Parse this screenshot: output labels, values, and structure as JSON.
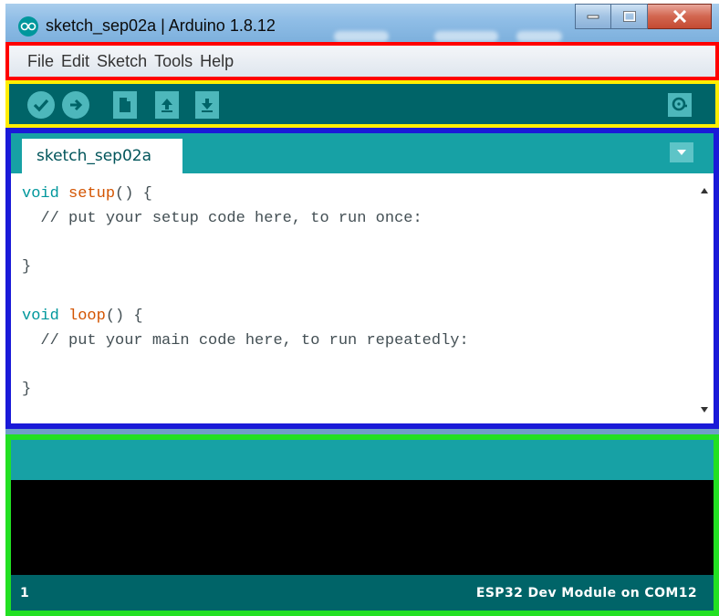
{
  "window": {
    "title": "sketch_sep02a | Arduino 1.8.12",
    "icon": "arduino-logo-icon",
    "controls": [
      "minimize-icon",
      "maximize-icon",
      "close-icon"
    ]
  },
  "menubar": {
    "items": [
      "File",
      "Edit",
      "Sketch",
      "Tools",
      "Help"
    ]
  },
  "toolbar": {
    "buttons": [
      "verify-icon",
      "upload-icon",
      "new-icon",
      "open-icon",
      "save-icon"
    ],
    "serial_monitor": "serial-monitor-icon"
  },
  "editor": {
    "tab_label": "sketch_sep02a",
    "code_lines": [
      {
        "kw": "void",
        "fn": "setup",
        "rest": "() {"
      },
      {
        "text": "  // put your setup code here, to run once:"
      },
      {
        "text": ""
      },
      {
        "text": "}"
      },
      {
        "text": ""
      },
      {
        "kw": "void",
        "fn": "loop",
        "rest": "() {"
      },
      {
        "text": "  // put your main code here, to run repeatedly:"
      },
      {
        "text": ""
      },
      {
        "text": "}"
      }
    ]
  },
  "status": {
    "line_number": "1",
    "board_port": "ESP32 Dev Module on COM12"
  },
  "colors": {
    "teal_dark": "#006468",
    "teal": "#17a1a5",
    "keyword": "#00979c",
    "function": "#d35400",
    "outline_menu": "#ff0000",
    "outline_toolbar": "#ffee00",
    "outline_editor": "#1a1ad8",
    "outline_console": "#22e022"
  }
}
